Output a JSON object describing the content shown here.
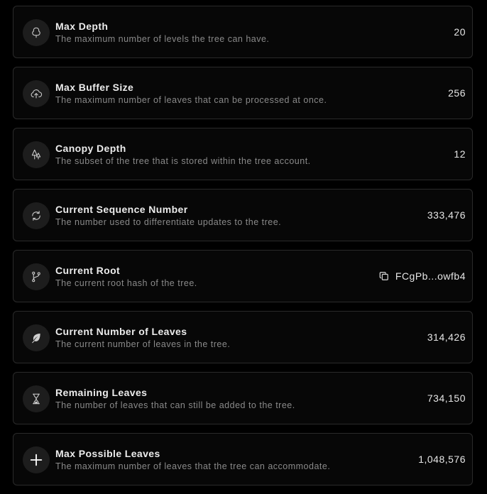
{
  "rows": [
    {
      "title": "Max Depth",
      "description": "The maximum number of levels the tree can have.",
      "value": "20",
      "icon": "tree-icon"
    },
    {
      "title": "Max Buffer Size",
      "description": "The maximum number of leaves that can be processed at once.",
      "value": "256",
      "icon": "cloud-upload-icon"
    },
    {
      "title": "Canopy Depth",
      "description": "The subset of the tree that is stored within the tree account.",
      "value": "12",
      "icon": "trees-icon"
    },
    {
      "title": "Current Sequence Number",
      "description": "The number used to differentiate updates to the tree.",
      "value": "333,476",
      "icon": "refresh-icon"
    },
    {
      "title": "Current Root",
      "description": "The current root hash of the tree.",
      "value": "FCgPb...owfb4",
      "icon": "git-branch-icon",
      "copy_icon": "copy-icon"
    },
    {
      "title": "Current Number of Leaves",
      "description": "The current number of leaves in the tree.",
      "value": "314,426",
      "icon": "leaf-icon"
    },
    {
      "title": "Remaining Leaves",
      "description": "The number of leaves that can still be added to the tree.",
      "value": "734,150",
      "icon": "hourglass-icon"
    },
    {
      "title": "Max Possible Leaves",
      "description": "The maximum number of leaves that the tree can accommodate.",
      "value": "1,048,576",
      "icon": "plus-icon"
    }
  ]
}
